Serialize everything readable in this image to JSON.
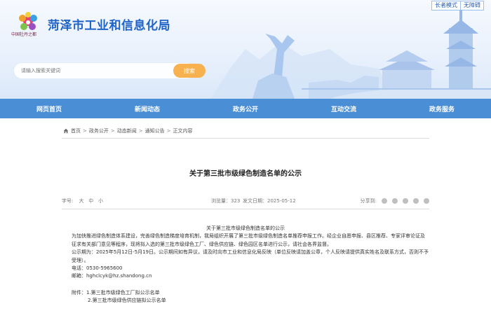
{
  "header": {
    "site_title": "菏泽市工业和信息化局",
    "logo_caption": "中国牡丹之都",
    "top_links": [
      "长者模式",
      "无障碍"
    ],
    "search_placeholder": "请输入搜索关键词",
    "search_button": "搜索"
  },
  "nav": {
    "items": [
      "网页首页",
      "新闻动态",
      "政务公开",
      "互动交流",
      "政务服务"
    ]
  },
  "breadcrumb": [
    "首页",
    "政务公开",
    "动态新闻",
    "通知公告",
    "正文内容"
  ],
  "article": {
    "title": "关于第三批市级绿色制造名单的公示",
    "font_size_label": "字号:",
    "font_sizes": [
      "大",
      "中",
      "小"
    ],
    "views_label": "浏览量：",
    "views": "323",
    "date_label": "发文日期：",
    "date": "2025-05-12",
    "share_label": "分享到:",
    "share_icons": [
      "wechat-icon",
      "weibo-icon",
      "qq-icon",
      "qzone-icon",
      "print-icon"
    ],
    "content_title": "关于第三批市级绿色制造名单的公示",
    "para1": "为加快推进绿色制造体系建设，完善绿色制造梯度培育机制，我局组织开展了第三批市级绿色制造名单推荐申报工作。经企业自愿申报、县区推荐、专家评审论证及征求有关部门意见等程序，现将拟入选的第三批市级绿色工厂、绿色供应链、绿色园区名单进行公示，请社会各界监督。",
    "para2": "公示期为：2025年5月12日-5月19日。公示期间如有异议，请及时向市工业和信息化局反映（单位反映请加盖公章，个人反映请提供真实姓名及联系方式，否则不予受理）。",
    "phone": "电话：0530-5965600",
    "email": "邮箱：hghclcyk@hz.shandong.cn",
    "attachment1": "附件：1.第三批市级绿色工厂拟公示名单",
    "attachment2": "2.第三批市级绿色供应链拟公示名单"
  }
}
